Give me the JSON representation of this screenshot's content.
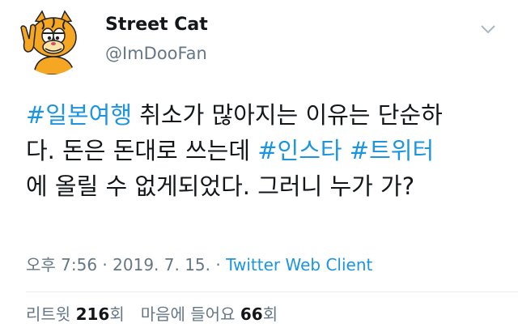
{
  "user": {
    "display_name": "Street Cat",
    "handle": "@ImDooFan",
    "avatar_icon": "cartoon-cat-avatar-icon"
  },
  "header": {
    "more_icon": "chevron-down-icon"
  },
  "tweet": {
    "lines": [
      [
        {
          "text": "#일본여행",
          "hashtag": true
        },
        {
          "text": " 취소가 많아지는 이유는 단순하",
          "hashtag": false
        }
      ],
      [
        {
          "text": "다. 돈은 돈대로 쓰는데 ",
          "hashtag": false
        },
        {
          "text": "#인스타",
          "hashtag": true
        },
        {
          "text": " ",
          "hashtag": false
        },
        {
          "text": "#트위터",
          "hashtag": true
        }
      ],
      [
        {
          "text": "에 올릴 수 없게되었다. 그러니 누가 가?",
          "hashtag": false
        }
      ]
    ]
  },
  "meta": {
    "time": "오후 7:56",
    "separator": " · ",
    "date": "2019. 7. 15.",
    "source": "Twitter Web Client"
  },
  "stats": {
    "retweet_label": "리트윗",
    "retweet_count": "216",
    "retweet_unit": "회",
    "like_label": "마음에 들어요",
    "like_count": "66",
    "like_unit": "회"
  },
  "colors": {
    "hashtag": "#1b95e0",
    "secondary_text": "#657786",
    "primary_text": "#14171a"
  }
}
